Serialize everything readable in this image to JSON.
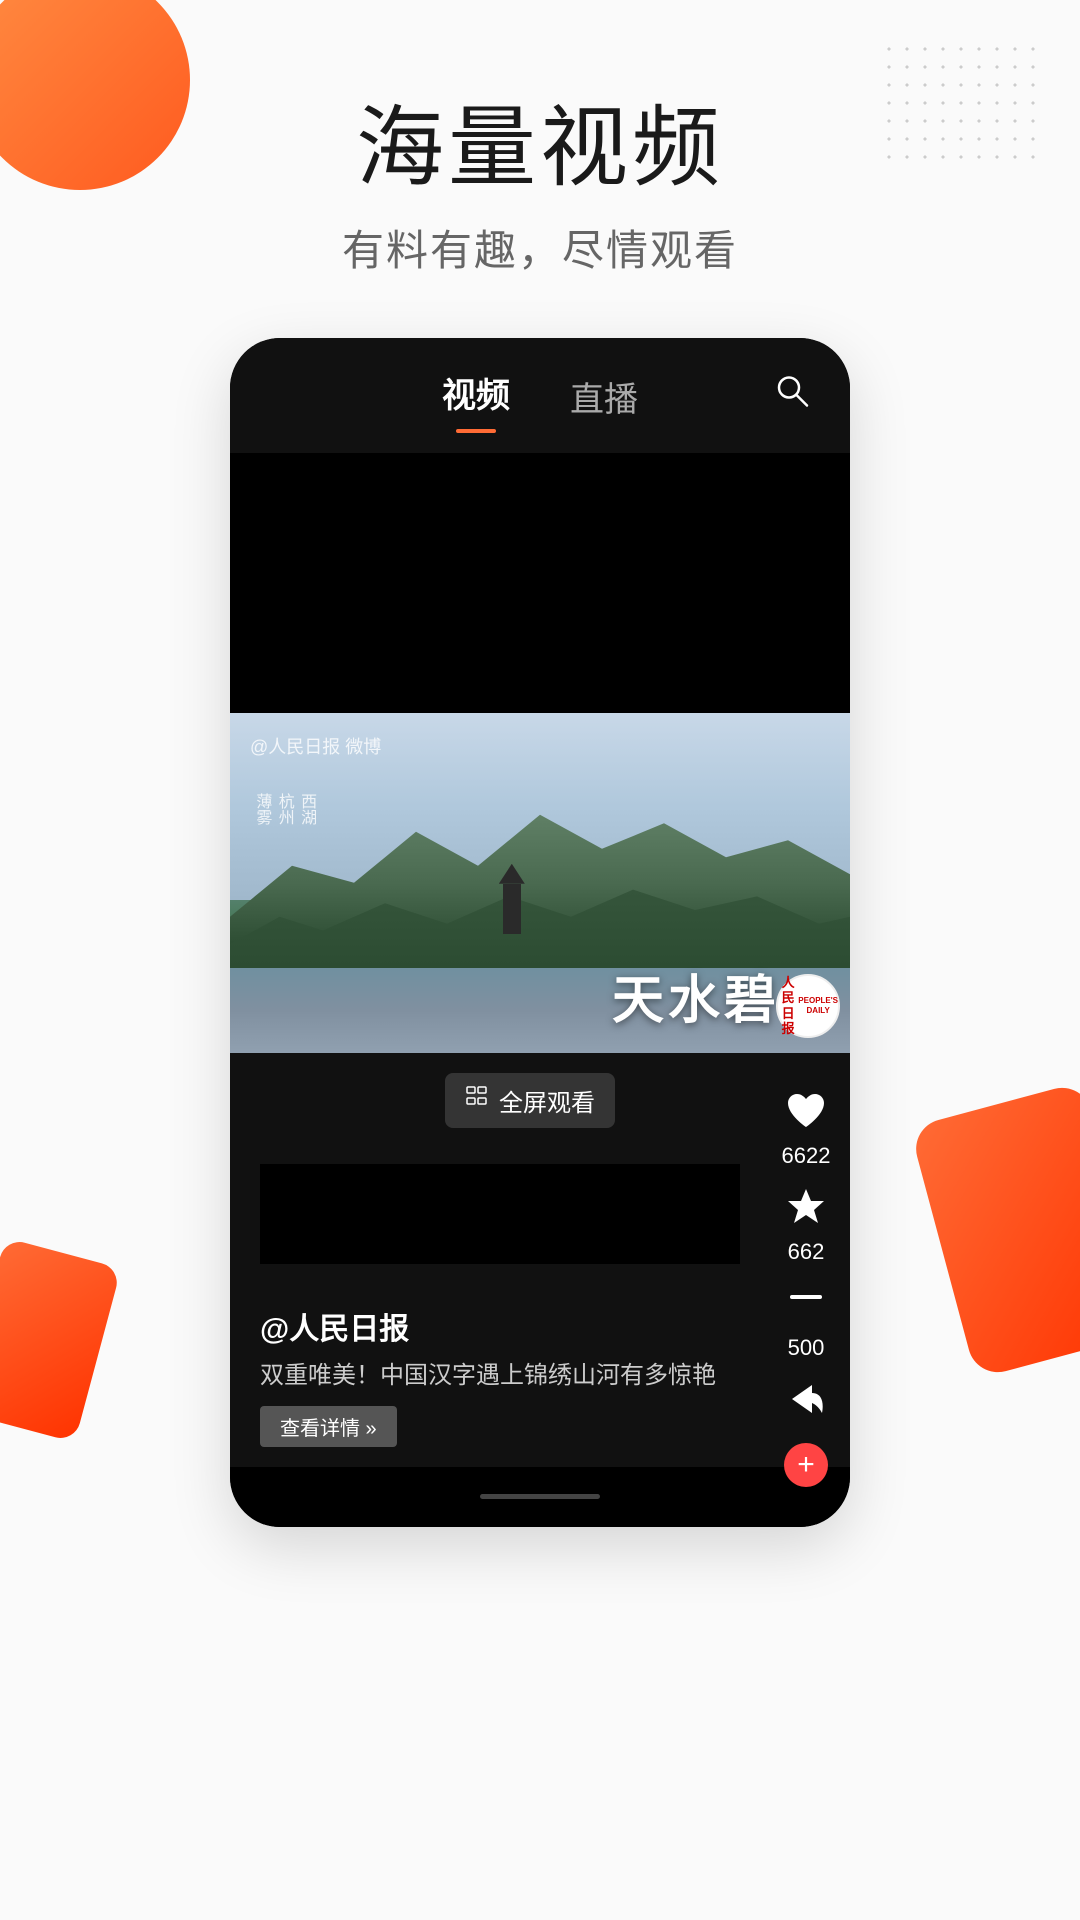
{
  "header": {
    "title": "海量视频",
    "subtitle": "有料有趣，尽情观看"
  },
  "app": {
    "nav": {
      "tab_video": "视频",
      "tab_live": "直播",
      "active_tab": "视频"
    },
    "video": {
      "watermark": "@人民日报 微博",
      "side_text_1": "薄雾",
      "side_text_2": "杭州",
      "side_text_3": "西湖",
      "title_overlay": "天水碧",
      "publisher_name_cn": "人民日报",
      "publisher_name_en": "PEOPLE'S DAILY",
      "fullscreen_label": "全屏观看",
      "author": "@人民日报",
      "description": "双重唯美！中国汉字遇上锦绣山河有多惊艳",
      "read_more": "查看详情 »",
      "likes": "6622",
      "favorites": "662",
      "comments": "500"
    }
  },
  "icons": {
    "search": "○",
    "plus": "+",
    "heart": "♥",
    "star": "★",
    "comment": "—",
    "share": "↱",
    "fullscreen": "⊡"
  }
}
